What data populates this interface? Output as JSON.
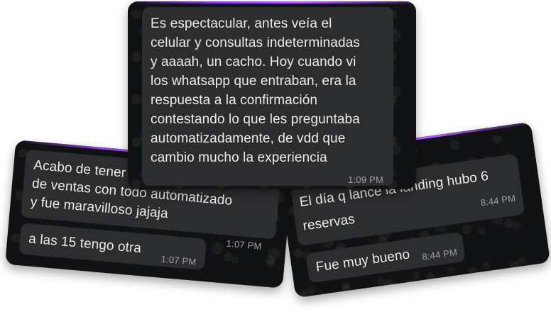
{
  "cards": {
    "top": {
      "message": {
        "lines": [
          "Es espectacular, antes veía el",
          "celular y consultas indeterminadas",
          "y aaaah, un cacho. Hoy cuando vi",
          "los whatsapp que entraban, era la",
          "respuesta a la confirmación",
          "contestando lo que les preguntaba",
          "automatizadamente, de vdd que",
          "cambio mucho la experiencia"
        ],
        "time": "1:09 PM"
      }
    },
    "left": {
      "message_1": {
        "lines": [
          "Acabo de tener la primera llamada",
          "de ventas con todo automatizado",
          "y fue maravilloso jajaja"
        ],
        "time": "1:07 PM"
      },
      "message_2": {
        "text": "a las 15 tengo otra",
        "time": "1:07 PM"
      }
    },
    "right": {
      "message_1": {
        "lines": [
          "El día q lance la landing hubo 6",
          "reservas"
        ],
        "time": "8:44 PM"
      },
      "message_2": {
        "text": "Fue muy bueno",
        "time": "8:44 PM"
      }
    }
  },
  "colors": {
    "card_bg": "#111213",
    "bubble_bg": "#2c2d2f",
    "text": "#ececec",
    "time": "#9fa1a4",
    "accent": "#8c3cdc"
  }
}
